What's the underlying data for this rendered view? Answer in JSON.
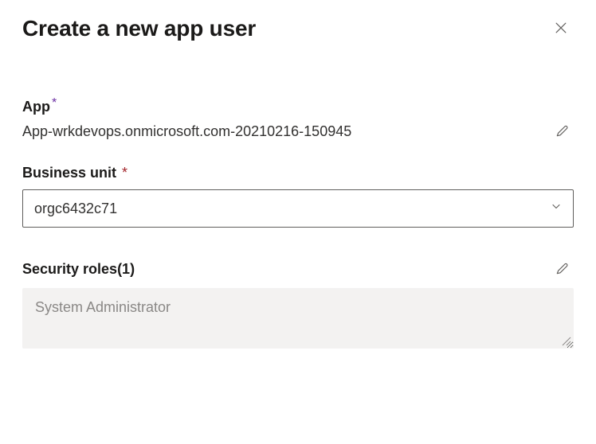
{
  "header": {
    "title": "Create a new app user"
  },
  "app": {
    "label": "App",
    "value": "App-wrkdevops.onmicrosoft.com-20210216-150945"
  },
  "business_unit": {
    "label": "Business unit",
    "selected": "orgc6432c71"
  },
  "security_roles": {
    "label": "Security roles",
    "count": "(1)",
    "value": "System Administrator"
  }
}
